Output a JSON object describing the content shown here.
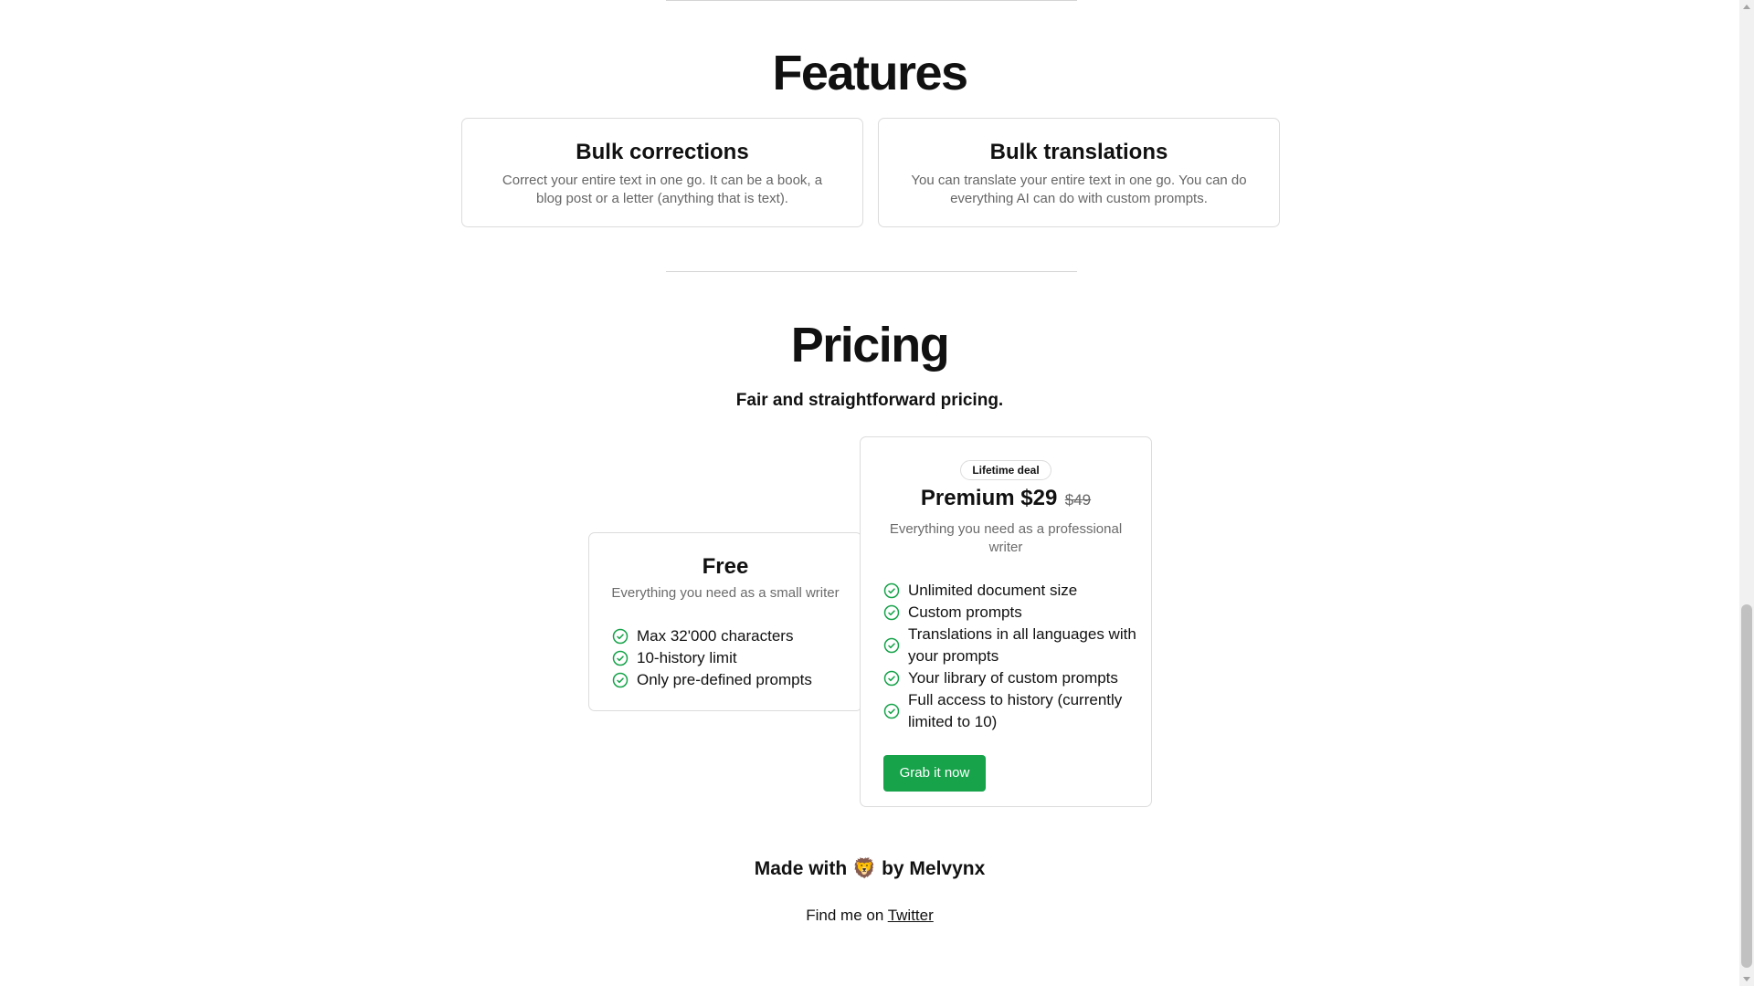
{
  "features": {
    "title": "Features",
    "cards": [
      {
        "title": "Bulk corrections",
        "description": "Correct your entire text in one go. It can be a book, a blog post or a letter (anything that is text)."
      },
      {
        "title": "Bulk translations",
        "description": "You can translate your entire text in one go. You can do everything AI can do with custom prompts."
      }
    ]
  },
  "pricing": {
    "title": "Pricing",
    "subtitle": "Fair and straightforward pricing.",
    "free": {
      "name": "Free",
      "description": "Everything you need as a small writer",
      "features": [
        "Max 32'000 characters",
        "10-history limit",
        "Only pre-defined prompts"
      ]
    },
    "premium": {
      "badge": "Lifetime deal",
      "name": "Premium $29",
      "old_price": "$49",
      "description": "Everything you need as a professional writer",
      "features": [
        "Unlimited document size",
        "Custom prompts",
        "Translations in all languages with your prompts",
        "Your library of custom prompts",
        "Full access to history (currently limited to 10)"
      ],
      "cta_label": "Grab it now"
    }
  },
  "footer": {
    "made_with_prefix": "Made with",
    "emoji": "🦁",
    "made_with_suffix": "by Melvynx",
    "find_me_prefix": "Find me on",
    "twitter_label": "Twitter"
  },
  "colors": {
    "accent": "#16a34a",
    "check": "#16a34a",
    "border": "#dcdcdc",
    "muted_text": "#666666"
  },
  "icons": {
    "feature_check": "check-circle-icon"
  }
}
